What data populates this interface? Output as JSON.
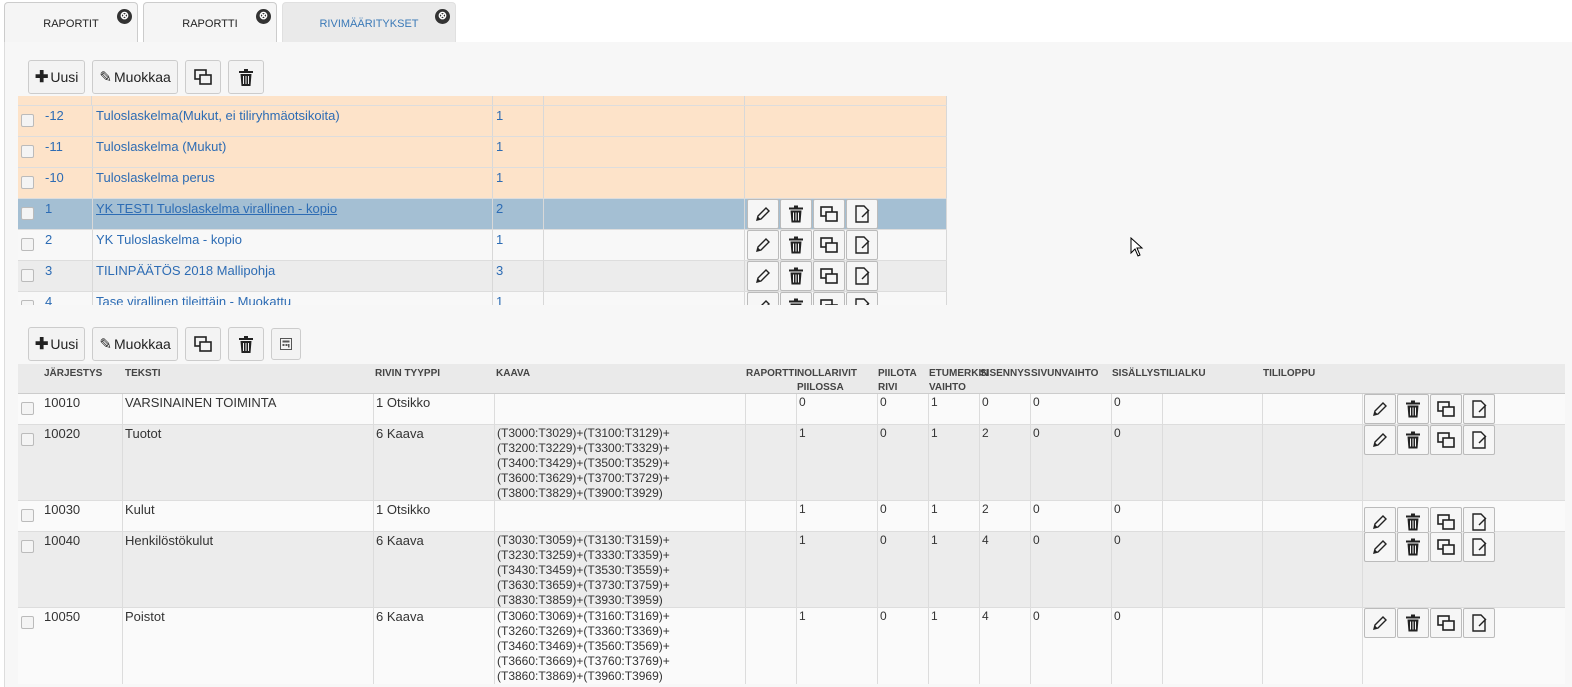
{
  "tabs": [
    {
      "label": "RAPORTIT",
      "close": "⊗"
    },
    {
      "label": "RAPORTTI",
      "close": "⊗"
    },
    {
      "label": "RIVIMÄÄRITYKSET",
      "close": "⊗"
    }
  ],
  "toolbar_top": {
    "new_label": "Uusi",
    "edit_label": "Muokkaa"
  },
  "toolbar_bottom": {
    "new_label": "Uusi",
    "edit_label": "Muokkaa"
  },
  "reports": [
    {
      "id": "-12",
      "name": "Tuloslaskelma(Mukut, ei tiliryhmäotsikoita)",
      "type": "1",
      "style": "orange"
    },
    {
      "id": "-11",
      "name": "Tuloslaskelma (Mukut)",
      "type": "1",
      "style": "orange"
    },
    {
      "id": "-10",
      "name": "Tuloslaskelma perus",
      "type": "1",
      "style": "orange"
    },
    {
      "id": "1",
      "name": "YK TESTI Tuloslaskelma virallinen - kopio",
      "type": "2",
      "style": "selected"
    },
    {
      "id": "2",
      "name": "YK Tuloslaskelma - kopio",
      "type": "1",
      "style": "white"
    },
    {
      "id": "3",
      "name": "TILINPÄÄTÖS 2018 Mallipohja",
      "type": "3",
      "style": "gray"
    },
    {
      "id": "4",
      "name": "Tase virallinen tileittäin - Muokattu",
      "type": "1",
      "style": "white"
    }
  ],
  "columns": {
    "jarjestys": "JÄRJESTYS",
    "teksti": "TEKSTI",
    "tyyppi": "RIVIN TYYPPI",
    "kaava": "KAAVA",
    "raportti": "RAPORTTI",
    "nollarivit": "NOLLARIVIT\nPIILOSSA",
    "piilota": "PIILOTA\nRIVI",
    "etumerkki": "ETUMERKIN\nVAIHTO",
    "sisennys": "SISENNYS",
    "sivunvaihto": "SIVUNVAIHTO",
    "sisallys": "SISÄLLYS",
    "tilialku": "TILIALKU",
    "tililoppu": "TILILOPPU"
  },
  "rows": [
    {
      "jarjestys": "10010",
      "teksti": "VARSINAINEN TOIMINTA",
      "tyyppi": "1 Otsikko",
      "kaava": "",
      "nollarivit": "0",
      "piilota": "0",
      "etumerkki": "1",
      "sisennys": "0",
      "sivunvaihto": "0",
      "sisallys": "0"
    },
    {
      "jarjestys": "10020",
      "teksti": "Tuotot",
      "tyyppi": "6 Kaava",
      "kaava": "(T3000:T3029)+(T3100:T3129)+\n(T3200:T3229)+(T3300:T3329)+\n(T3400:T3429)+(T3500:T3529)+\n(T3600:T3629)+(T3700:T3729)+\n(T3800:T3829)+(T3900:T3929)",
      "nollarivit": "1",
      "piilota": "0",
      "etumerkki": "1",
      "sisennys": "2",
      "sivunvaihto": "0",
      "sisallys": "0"
    },
    {
      "jarjestys": "10030",
      "teksti": "Kulut",
      "tyyppi": "1 Otsikko",
      "kaava": "",
      "nollarivit": "1",
      "piilota": "0",
      "etumerkki": "1",
      "sisennys": "2",
      "sivunvaihto": "0",
      "sisallys": "0"
    },
    {
      "jarjestys": "10040",
      "teksti": "Henkilöstökulut",
      "tyyppi": "6 Kaava",
      "kaava": "(T3030:T3059)+(T3130:T3159)+\n(T3230:T3259)+(T3330:T3359)+\n(T3430:T3459)+(T3530:T3559)+\n(T3630:T3659)+(T3730:T3759)+\n(T3830:T3859)+(T3930:T3959)",
      "nollarivit": "1",
      "piilota": "0",
      "etumerkki": "1",
      "sisennys": "4",
      "sivunvaihto": "0",
      "sisallys": "0"
    },
    {
      "jarjestys": "10050",
      "teksti": "Poistot",
      "tyyppi": "6 Kaava",
      "kaava": "(T3060:T3069)+(T3160:T3169)+\n(T3260:T3269)+(T3360:T3369)+\n(T3460:T3469)+(T3560:T3569)+\n(T3660:T3669)+(T3760:T3769)+\n(T3860:T3869)+(T3960:T3969)",
      "nollarivit": "1",
      "piilota": "0",
      "etumerkki": "1",
      "sisennys": "4",
      "sivunvaihto": "0",
      "sisallys": "0"
    }
  ],
  "colors": {
    "orange_row": "#fde3c9",
    "selected_row": "#a4bfd3",
    "link": "#2d6cb4",
    "active_tab_text": "#3a79b7"
  }
}
